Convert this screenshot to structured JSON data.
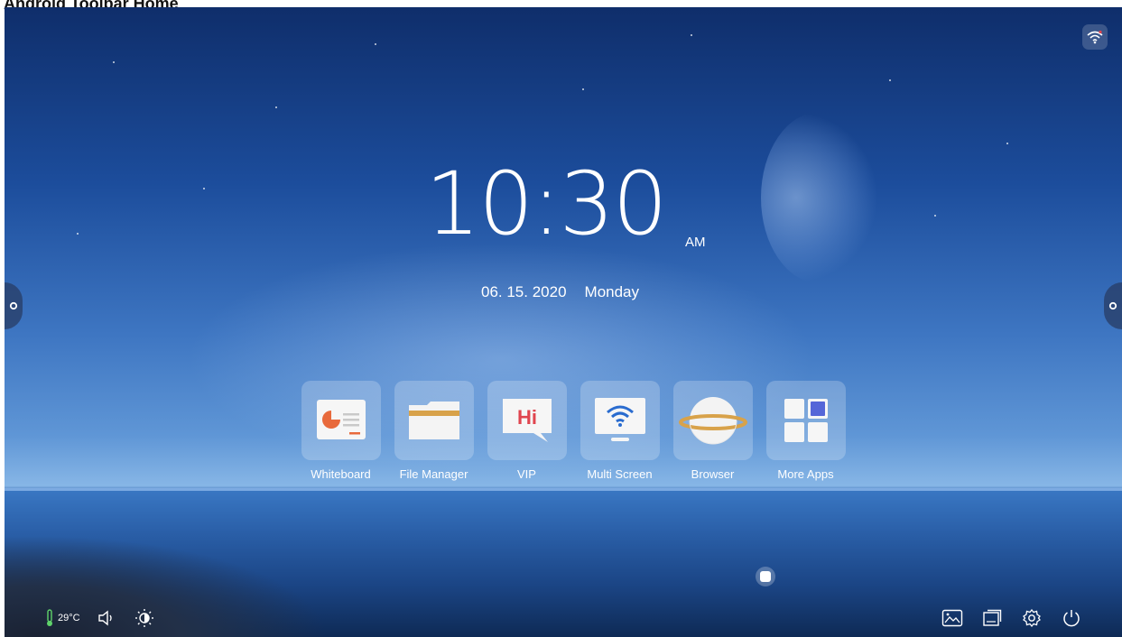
{
  "caption": "Android Toolbar Home",
  "clock": {
    "time": "10:30",
    "ampm": "AM"
  },
  "date": {
    "date": "06. 15. 2020",
    "weekday": "Monday"
  },
  "apps": [
    {
      "label": "Whiteboard",
      "icon": "whiteboard-icon"
    },
    {
      "label": "File Manager",
      "icon": "folder-icon"
    },
    {
      "label": "VIP",
      "icon": "chat-bubble-icon",
      "glyph": "Hi"
    },
    {
      "label": "Multi Screen",
      "icon": "wifi-screen-icon"
    },
    {
      "label": "Browser",
      "icon": "planet-icon"
    },
    {
      "label": "More Apps",
      "icon": "grid-icon"
    }
  ],
  "status": {
    "temperature": "29°C"
  },
  "colors": {
    "accent_orange": "#e86a3c",
    "folder_tan": "#d8a24a",
    "vip_red": "#e0454f",
    "wifi_blue": "#2a6ccf",
    "grid_blue": "#5566d8"
  }
}
